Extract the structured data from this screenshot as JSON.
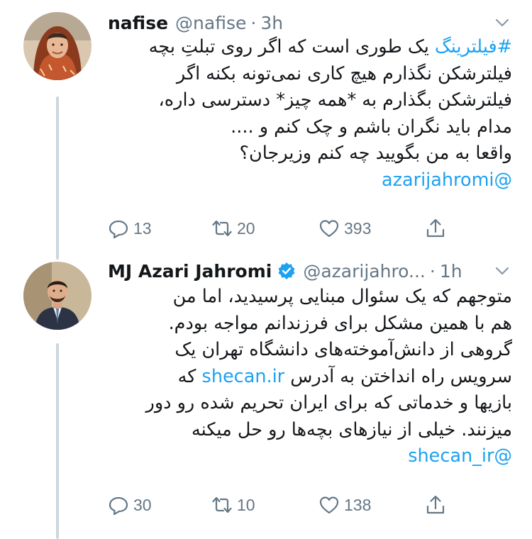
{
  "tweets": [
    {
      "name": "nafise",
      "handle": "@nafise",
      "dot": "·",
      "time": "3h",
      "verified": false,
      "avatar_icon": "woman-headscarf-avatar",
      "lines": [
        {
          "prefix_link": "#فیلترینگ",
          "text": " یک طوری است که اگر روی تبلتِ بچه"
        },
        {
          "text": "فیلترشکن نگذارم هیچ کاری نمی‌تونه بکنه اگر"
        },
        {
          "text": "فیلترشکن بگذارم به *همه چیز* دسترسی داره،"
        },
        {
          "text": "مدام باید نگران باشم و چک کنم و ...."
        },
        {
          "text": "واقعا به من بگویید چه کنم وزیرجان؟"
        },
        {
          "link": "@azarijahromi"
        }
      ],
      "replies": "13",
      "retweets": "20",
      "likes": "393"
    },
    {
      "name": "MJ Azari Jahromi",
      "handle": "@azarijahro...",
      "dot": "·",
      "time": "1h",
      "verified": true,
      "avatar_icon": "man-suit-avatar",
      "lines": [
        {
          "text": "متوجهم که یک سئوال مبنایی پرسیدید، اما من"
        },
        {
          "text": "هم با همین مشکل برای فرزندانم مواجه بودم."
        },
        {
          "text": "گروهی از دانش‌آموخته‌های دانشگاه تهران یک"
        },
        {
          "text_before": "سرویس راه انداختن به آدرس ",
          "mid_link": "shecan.ir",
          "text_after": " که"
        },
        {
          "text": "بازیها و خدماتی که برای ایران تحریم شده رو دور"
        },
        {
          "text": "میزنند. خیلی از نیازهای بچه‌ها رو حل میکنه"
        },
        {
          "link": "@shecan_ir"
        }
      ],
      "replies": "30",
      "retweets": "10",
      "likes": "138"
    }
  ],
  "colors": {
    "link": "#1da1f2",
    "muted": "#657786",
    "verified": "#1da1f2",
    "thread_line": "#ccd6dd"
  }
}
